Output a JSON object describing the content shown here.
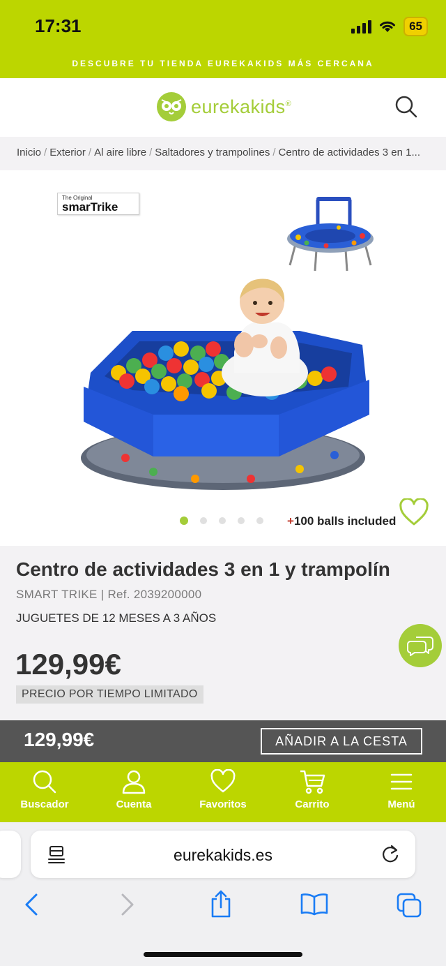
{
  "status": {
    "time": "17:31",
    "battery": "65"
  },
  "promo": "DESCUBRE TU TIENDA EUREKAKIDS MÁS CERCANA",
  "header": {
    "logo_text": "eurekakids"
  },
  "breadcrumb": [
    "Inicio",
    "Exterior",
    "Al aire libre",
    "Saltadores y trampolines",
    "Centro de actividades 3 en 1..."
  ],
  "gallery": {
    "brand_small": "The Original",
    "brand_name": "smarTrike",
    "slide_count": 5,
    "active_slide": 1,
    "balls_plus": "+",
    "balls_text": "100 balls included"
  },
  "product": {
    "title": "Centro de actividades 3 en 1 y trampolín",
    "brand": "SMART TRIKE",
    "ref": "Ref. 2039200000",
    "age": "JUGUETES DE 12 MESES A 3 AÑOS",
    "price": "129,99€",
    "limited": "PRECIO POR TIEMPO LIMITADO"
  },
  "cart_bar": {
    "price": "129,99€",
    "button": "AÑADIR A LA CESTA"
  },
  "nav": [
    {
      "label": "Buscador",
      "icon": "search-icon"
    },
    {
      "label": "Cuenta",
      "icon": "user-icon"
    },
    {
      "label": "Favoritos",
      "icon": "heart-icon"
    },
    {
      "label": "Carrito",
      "icon": "cart-icon"
    },
    {
      "label": "Menú",
      "icon": "menu-icon"
    }
  ],
  "browser": {
    "url": "eurekakids.es"
  },
  "colors": {
    "brand_green": "#bcd600",
    "logo_green": "#a4cd39",
    "cart_bar": "#555555"
  }
}
